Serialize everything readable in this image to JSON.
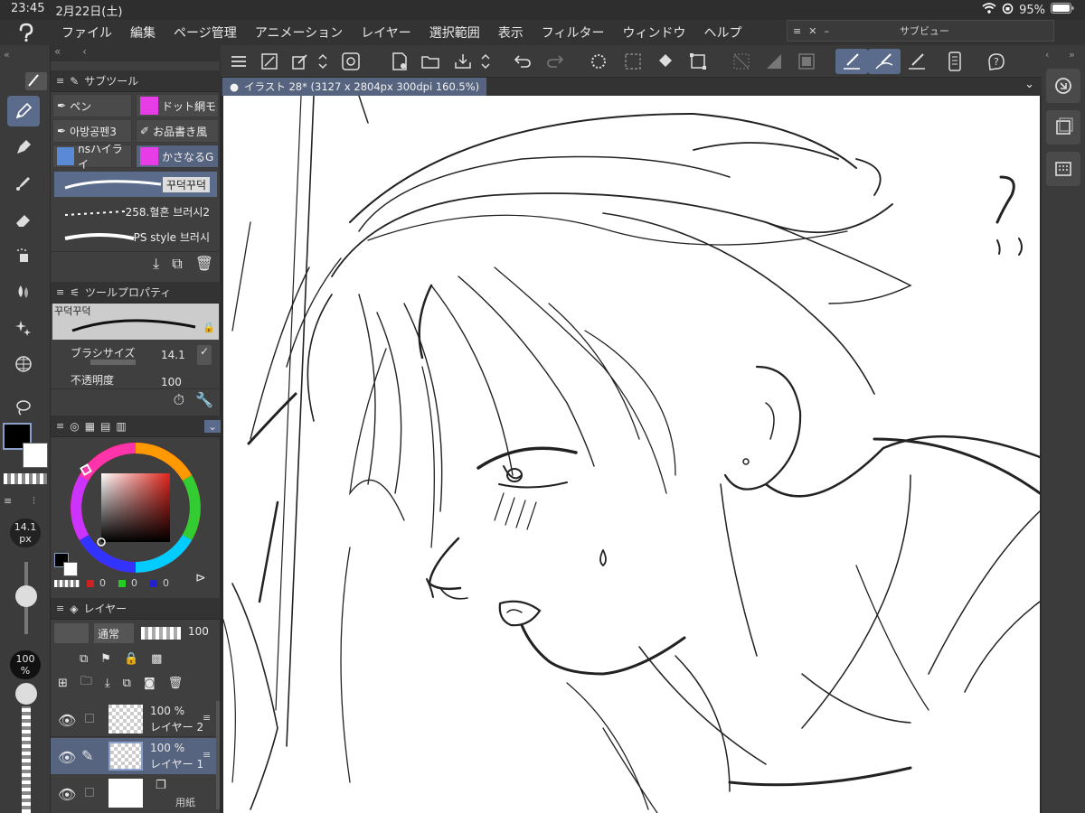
{
  "status": {
    "time": "23:45",
    "date": "2月22日(土)",
    "battery": "95%"
  },
  "menu": [
    "ファイル",
    "編集",
    "ページ管理",
    "アニメーション",
    "レイヤー",
    "選択範囲",
    "表示",
    "フィルター",
    "ウィンドウ",
    "ヘルプ"
  ],
  "subview": {
    "title": "サブビュー"
  },
  "subtool_panel": {
    "tab": "サブツール",
    "tools": [
      {
        "label": "ペン"
      },
      {
        "label": "ドット網モ"
      },
      {
        "label": "아방공펜3"
      },
      {
        "label": "お品書き風"
      },
      {
        "label": "nsハイライ"
      },
      {
        "label": "かさなるG"
      }
    ],
    "brushes": [
      {
        "label": "꾸덕꾸덕"
      },
      {
        "label": "258.혈흔 브러시2"
      },
      {
        "label": "PS style 브러시"
      }
    ]
  },
  "tool_property": {
    "tab": "ツールプロパティ",
    "preview_name": "꾸덕꾸덕",
    "brush_size_label": "ブラシサイズ",
    "brush_size_value": "14.1",
    "opacity_label": "不透明度",
    "opacity_value": "100"
  },
  "color": {
    "main": "#000000",
    "sub": "#ffffff",
    "rgb": {
      "r": "0",
      "g": "0",
      "b": "0"
    }
  },
  "left_sliders": {
    "size_value": "14.1",
    "size_unit": "px",
    "opacity": "100",
    "opacity_unit": "%"
  },
  "layers": {
    "tab": "レイヤー",
    "blend": "通常",
    "opacity": "100",
    "items": [
      {
        "opacity": "100 %",
        "name": "レイヤー 2"
      },
      {
        "opacity": "100 %",
        "name": "レイヤー 1"
      },
      {
        "opacity": "",
        "name": "用紙"
      }
    ]
  },
  "document": {
    "tab": "イラスト 28* (3127 x 2804px 300dpi 160.5%)"
  },
  "colors": {
    "accent": "#5b6b8c",
    "panel": "#3f3f3f",
    "canvas": "#ffffff"
  }
}
